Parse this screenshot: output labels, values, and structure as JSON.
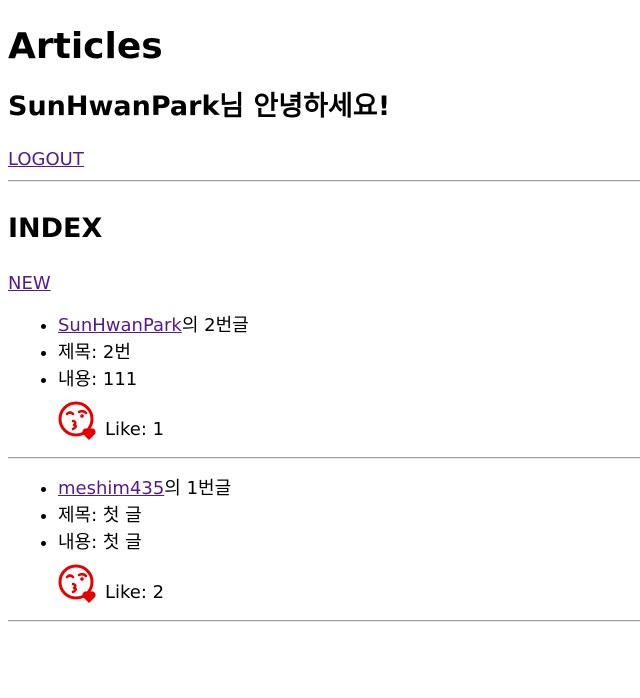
{
  "header": {
    "title": "Articles",
    "greeting": "SunHwanPark님 안녕하세요!",
    "logout_label": "LOGOUT"
  },
  "index": {
    "title": "INDEX",
    "new_label": "NEW"
  },
  "articles": [
    {
      "author": "SunHwanPark",
      "number_suffix": "의 2번글",
      "title_line": "제목: 2번",
      "content_line": "내용: 111",
      "like_text": "Like: 1",
      "like_icon": "kiss-heart-icon"
    },
    {
      "author": "meshim435",
      "number_suffix": "의 1번글",
      "title_line": "제목: 첫 글",
      "content_line": "내용: 첫 글",
      "like_text": "Like: 2",
      "like_icon": "kiss-heart-icon"
    }
  ],
  "colors": {
    "link": "#551a8b",
    "icon": "#e60000"
  }
}
